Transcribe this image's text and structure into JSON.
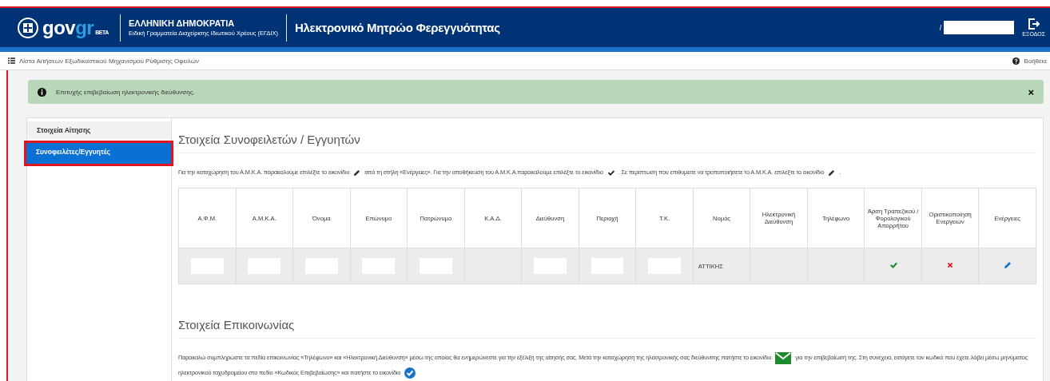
{
  "header": {
    "logo": {
      "text": "gov",
      "accent": "gr",
      "badge": "BETA"
    },
    "org_title": "ΕΛΛΗΝΙΚΗ ΔΗΜΟΚΡΑΤΙΑ",
    "org_subtitle": "Ειδική Γραμματεία Διαχείρισης Ιδιωτικού Χρέους (ΕΓΔΙΧ)",
    "app_title": "Ηλεκτρονικό Μητρώο Φερεγγυότητας",
    "user_prefix": "/",
    "logout_label": "ΕΞΟΔΟΣ"
  },
  "breadcrumb": {
    "label": "Λίστα Αιτήσεων Εξωδικαστικού Μηχανισμού Ρύθμισης Οφειλών",
    "help": "Βοήθεια"
  },
  "alert": {
    "text": "Επιτυχής επιβεβαίωση ηλεκτρονικής διεύθυνσης.",
    "close": "×"
  },
  "sidebar": {
    "items": [
      {
        "label": "Στοιχεία Αίτησης",
        "selected": false
      },
      {
        "label": "Συνοφειλέτες/Εγγυητές",
        "selected": true
      }
    ]
  },
  "section1": {
    "title": "Στοιχεία Συνοφειλετών / Εγγυητών",
    "instructions": [
      {
        "kind": "text",
        "text": "Για την καταχώρηση του Α.Μ.Κ.Α. παρακαλούμε επιλέξτε το εικονίδιο"
      },
      {
        "kind": "pencil"
      },
      {
        "kind": "text",
        "text": "από τη στήλη «Ενέργειες». Για την αποθήκευση του Α.Μ.Κ.Α.παρακαλούμε επιλέξτε το εικονίδιο"
      },
      {
        "kind": "tick"
      },
      {
        "kind": "text",
        "text": ". Σε περίπτωση που επιθυμειτε να τροποποιήσετε το Α.Μ.Κ.Α. επιλέξτε το εικονίδιο"
      },
      {
        "kind": "pencil"
      },
      {
        "kind": "text",
        "text": "."
      }
    ]
  },
  "table": {
    "columns": [
      "Α.Φ.Μ.",
      "Α.Μ.Κ.Α.",
      "Όνομα",
      "Επώνυμο",
      "Πατρώνυμο",
      "Κ.Α.Δ.",
      "Διεύθυνση",
      "Περιοχή",
      "Τ.Κ.",
      "Νομός",
      "Ηλεκτρονική Διεύθυνση",
      "Τηλέφωνο",
      "Άρση Τραπεζικού / Φορολογικού Απορρήτου",
      "Οριστικοποίηση Ενεργειών",
      "Ενέργειες"
    ],
    "rows": [
      [
        {
          "kind": "redacted"
        },
        {
          "kind": "redacted"
        },
        {
          "kind": "redacted"
        },
        {
          "kind": "redacted"
        },
        {
          "kind": "redacted"
        },
        {
          "kind": "empty"
        },
        {
          "kind": "redacted"
        },
        {
          "kind": "redacted"
        },
        {
          "kind": "redacted"
        },
        {
          "kind": "text",
          "text": "ΑΤΤΙΚΗΣ"
        },
        {
          "kind": "empty"
        },
        {
          "kind": "empty"
        },
        {
          "kind": "check"
        },
        {
          "kind": "cross"
        },
        {
          "kind": "edit"
        }
      ]
    ]
  },
  "section2": {
    "title": "Στοιχεία Επικοινωνίας",
    "instructions": [
      {
        "kind": "text",
        "text": "Παρακαλώ συμπληρώστε τα πεδία επικοινωνίας «Τηλέφωνο» και «Ηλεκτρονική Διεύθυνση» μέσω της οποίας θα ενημερώνεστε για την εξέλιξη της αίτησής σας. Μετά την καταχώρηση της ηλεκτρονικής σας διεύθυνσης πατήστε το εικονίδιο"
      },
      {
        "kind": "envelope"
      },
      {
        "kind": "text",
        "text": "για την επιβεβαίωσή της. Στη συνέχεια, εισάγετε τον κωδικό που έχετε λάβει μέσω μηνύματος"
      },
      {
        "kind": "text",
        "text": "ηλεκτρονικού ταχυδρομείου στο πεδίο «Κωδικός Επιβεβαίωσης» και πατήστε το εικονίδιο"
      },
      {
        "kind": "confirm"
      }
    ]
  }
}
